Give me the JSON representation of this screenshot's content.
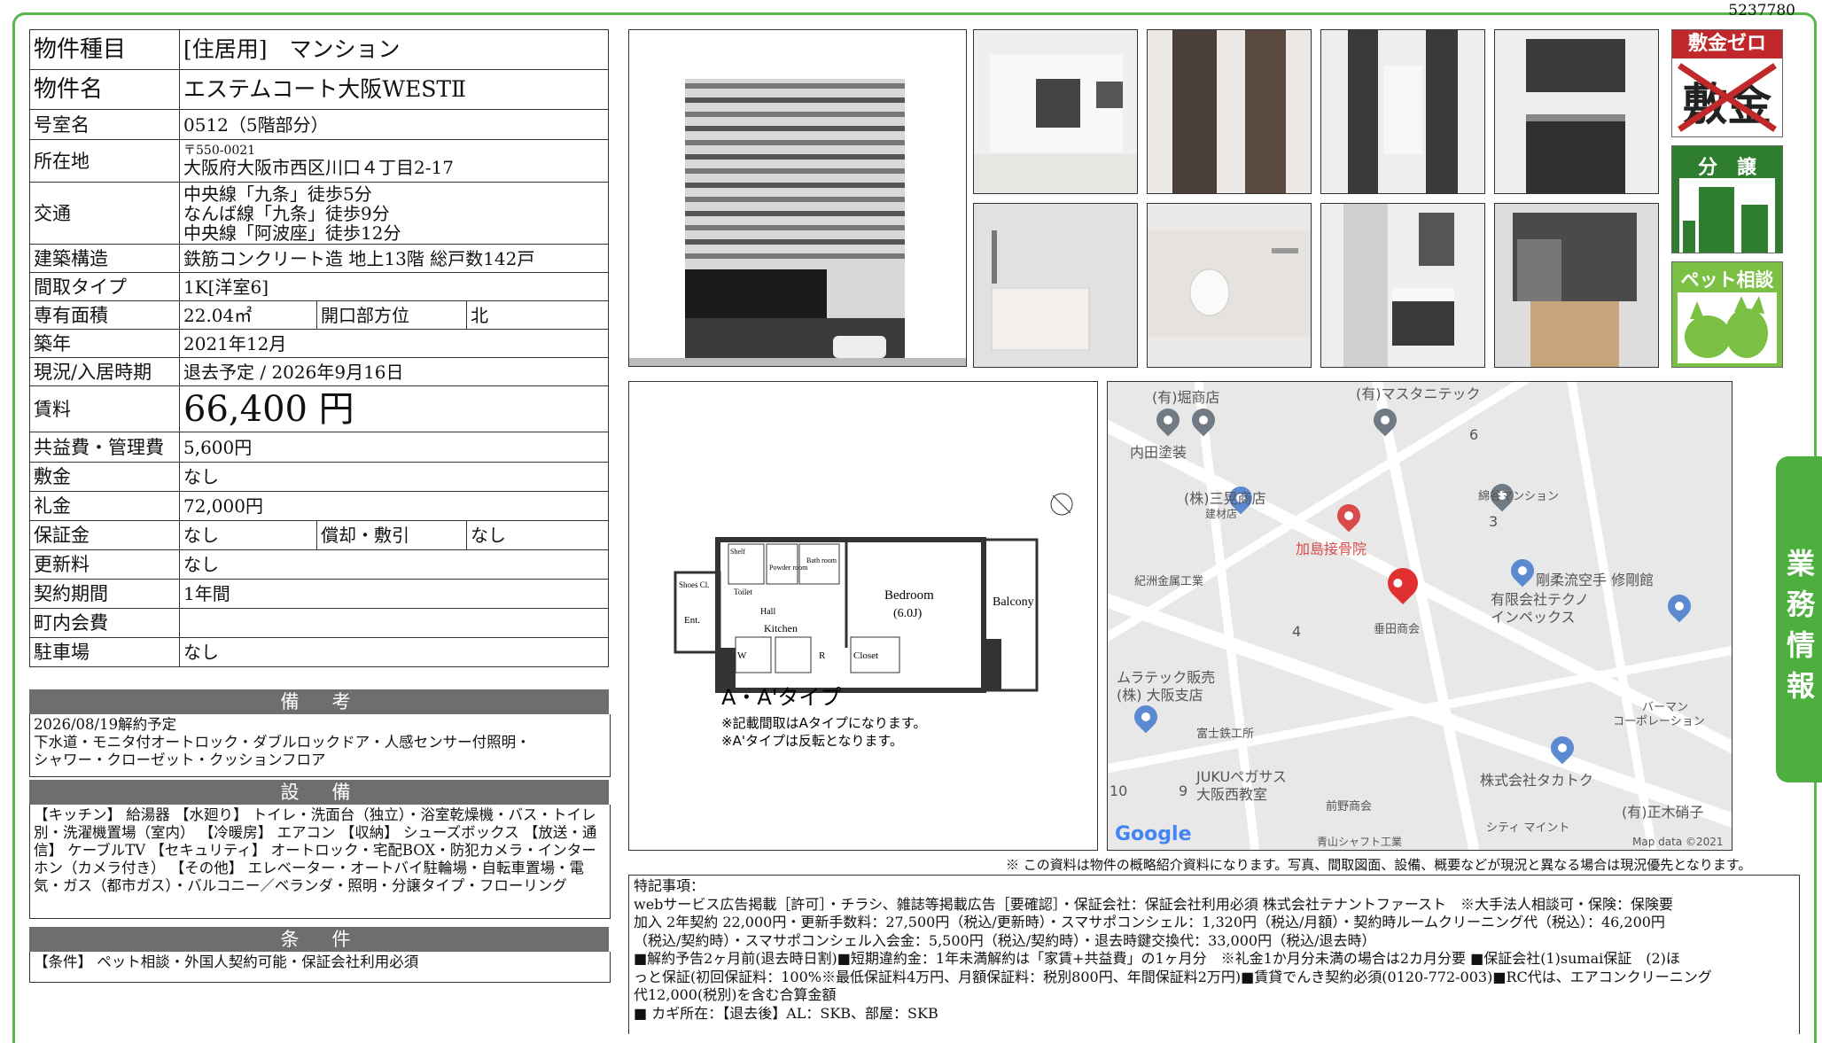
{
  "doc_id": "5237780",
  "table": {
    "type_label": "物件種目",
    "type_value": "[住居用]　マンション",
    "name_label": "物件名",
    "name_value": "エステムコート大阪WESTⅡ",
    "room_label": "号室名",
    "room_value": "0512（5階部分）",
    "addr_label": "所在地",
    "addr_zip": "〒550-0021",
    "addr_value": "大阪府大阪市西区川口４丁目2-17",
    "traffic_label": "交通",
    "traffic_1": "中央線「九条」徒歩5分",
    "traffic_2": "なんば線「九条」徒歩9分",
    "traffic_3": "中央線「阿波座」徒歩12分",
    "structure_label": "建築構造",
    "structure_value": "鉄筋コンクリート造 地上13階 総戸数142戸",
    "layout_label": "間取タイプ",
    "layout_value": "1K[洋室6]",
    "area_label": "専有面積",
    "area_value": "22.04㎡",
    "dir_label": "開口部方位",
    "dir_value": "北",
    "built_label": "築年",
    "built_value": "2021年12月",
    "status_label": "現況/入居時期",
    "status_value": "退去予定 / 2026年9月16日",
    "rent_label": "賃料",
    "rent_value": "66,400 円",
    "fee_label": "共益費・管理費",
    "fee_value": "5,600円",
    "deposit_label": "敷金",
    "deposit_value": "なし",
    "key_label": "礼金",
    "key_value": "72,000円",
    "guarantee_label": "保証金",
    "guarantee_value": "なし",
    "amort_label": "償却・敷引",
    "amort_value": "なし",
    "renew_label": "更新料",
    "renew_value": "なし",
    "contract_label": "契約期間",
    "contract_value": "1年間",
    "town_label": "町内会費",
    "town_value": "",
    "parking_label": "駐車場",
    "parking_value": "なし"
  },
  "remarks": {
    "title": "備　考",
    "line1": "2026/08/19解約予定",
    "line2": "下水道・モニタ付オートロック・ダブルロックドア・人感センサー付照明・",
    "line3": "シャワー・クローゼット・クッションフロア"
  },
  "equipment": {
    "title": "設　備",
    "text": "【キッチン】 給湯器 【水廻り】 トイレ・洗面台（独立）・浴室乾燥機・バス・トイレ別・洗濯機置場（室内） 【冷暖房】 エアコン 【収納】 シューズボックス 【放送・通信】 ケーブルTV 【セキュリティ】 オートロック・宅配BOX・防犯カメラ・インターホン（カメラ付き） 【その他】 エレベーター・オートバイ駐輪場・自転車置場・電気・ガス（都市ガス）・バルコニー／ベランダ・照明・分譲タイプ・フローリング"
  },
  "conditions": {
    "title": "条　件",
    "text": "【条件】 ペット相談・外国人契約可能・保証会社利用必須"
  },
  "badges": {
    "shikikin_zero": "敷金ゼロ",
    "shikikin": "敷金",
    "bunjo": "分　譲",
    "pet": "ペット相談"
  },
  "side_tab": "業務情報",
  "floorplan": {
    "type_label": "A・A'タイプ",
    "note1": "※記載間取はAタイプになります。",
    "note2": "※A'タイプは反転となります。",
    "bedroom": "Bedroom",
    "bedroom_size": "(6.0J)",
    "balcony": "Balcony",
    "kitchen": "Kitchen",
    "hall": "Hall",
    "closet": "Closet",
    "shoes": "Shoes Cl.",
    "ent": "Ent.",
    "toilet": "Toilet",
    "powder": "Powder room",
    "bath": "Bath room",
    "shelf": "Shelf",
    "w": "W",
    "r": "R"
  },
  "map": {
    "labels": [
      "(有)堀商店",
      "(有)マスタニテック",
      "内田塗装",
      "(株)三晃商店",
      "建材店",
      "加島接骨院",
      "綿谷マンション",
      "紀洲金属工業",
      "剛柔流空手 修剛館",
      "有限会社テクノ",
      "インペックス",
      "垂田商会",
      "ムラテック販売",
      "(株) 大阪支店",
      "富士鉄工所",
      "バーマン",
      "コーポレーション",
      "JUKUペガサス",
      "大阪西教室",
      "前野商会",
      "株式会社タカトク",
      "(有)正木硝子",
      "青山シャフト工業",
      "シティ マイント",
      "Google",
      "Map data ©2021",
      "6",
      "3",
      "4",
      "9",
      "10"
    ]
  },
  "disclaimer": "※ この資料は物件の概略紹介資料になります。写真、間取図面、設備、概要などが現況と異なる場合は現況優先となります。",
  "special": {
    "title": "特記事項：",
    "line1": "webサービス広告掲載［許可］・チラシ、雑誌等掲載広告［要確認］・保証会社：保証会社利用必須 株式会社テナントファースト　※大手法人相談可・保険：保険要",
    "line2": "加入 2年契約 22,000円・更新手数料：27,500円（税込/更新時）・スマサポコンシェル：1,320円（税込/月額）・契約時ルームクリーニング代（税込）：46,200円",
    "line3": "（税込/契約時）・スマサポコンシェル入会金：5,500円（税込/契約時）・退去時鍵交換代：33,000円（税込/退去時）",
    "line4": "■解約予告2ヶ月前(退去時日割)■短期違約金：1年未満解約は「家賃+共益費」の1ヶ月分　※礼金1か月分未満の場合は2カ月分要 ■保証会社(1)sumai保証　(2)ほ",
    "line5": "っと保証(初回保証料：100%※最低保証料4万円、月額保証料：税別800円、年間保証料2万円)■賃貸でんき契約必須(0120-772-003)■RC代は、エアコンクリーニング",
    "line6": "代12,000(税別)を含む合算金額",
    "line7": "■ カギ所在：【退去後】AL：SKB、部屋：SKB"
  }
}
